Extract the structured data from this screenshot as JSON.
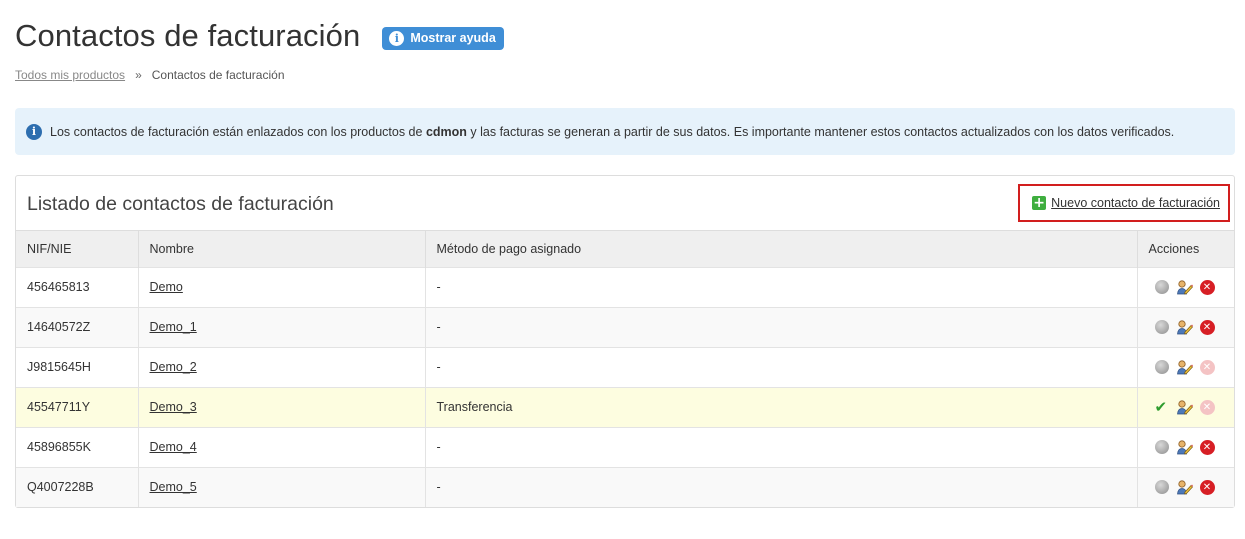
{
  "header": {
    "title": "Contactos de facturación",
    "help_label": "Mostrar ayuda"
  },
  "breadcrumb": {
    "root": "Todos mis productos",
    "separator": "»",
    "current": "Contactos de facturación"
  },
  "info": {
    "text_before": "Los contactos de facturación están enlazados con los productos de ",
    "brand": "cdmon",
    "text_after": " y las facturas se generan a partir de sus datos. Es importante mantener estos contactos actualizados con los datos verificados."
  },
  "panel": {
    "title": "Listado de contactos de facturación",
    "new_contact_label": "Nuevo contacto de facturación"
  },
  "table": {
    "headers": {
      "nif": "NIF/NIE",
      "nombre": "Nombre",
      "metodo": "Método de pago asignado",
      "acciones": "Acciones"
    },
    "rows": [
      {
        "nif": "456465813",
        "nombre": "Demo",
        "metodo": "-",
        "status_icon": "grey-dot-icon",
        "delete_enabled": true
      },
      {
        "nif": "14640572Z",
        "nombre": "Demo_1",
        "metodo": "-",
        "status_icon": "grey-dot-icon",
        "delete_enabled": true
      },
      {
        "nif": "J9815645H",
        "nombre": "Demo_2",
        "metodo": "-",
        "status_icon": "grey-dot-icon",
        "delete_enabled": false
      },
      {
        "nif": "45547711Y",
        "nombre": "Demo_3",
        "metodo": "Transferencia",
        "status_icon": "green-check-icon",
        "delete_enabled": false,
        "highlighted": true
      },
      {
        "nif": "45896855K",
        "nombre": "Demo_4",
        "metodo": "-",
        "status_icon": "grey-dot-icon",
        "delete_enabled": true
      },
      {
        "nif": "Q4007228B",
        "nombre": "Demo_5",
        "metodo": "-",
        "status_icon": "grey-dot-icon",
        "delete_enabled": true
      }
    ]
  },
  "colors": {
    "help_button": "#3f8ed6",
    "info_background": "#e6f2fb",
    "highlight_row": "#fdfde0",
    "delete_active": "#d71f25",
    "delete_disabled": "#f4c3c4",
    "focus_border": "#d21e1e",
    "add_icon": "#3fae3f"
  }
}
